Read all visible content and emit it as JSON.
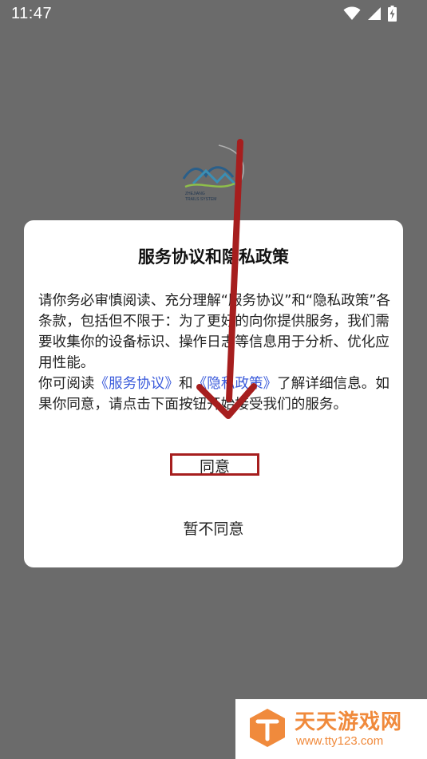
{
  "status_bar": {
    "time": "11:47",
    "icons": [
      "wifi-icon",
      "cellular-signal-icon",
      "battery-charging-icon"
    ]
  },
  "splash": {
    "logo_line1": "ZHEJIANG",
    "logo_line2": "TRAILS SYSTEM"
  },
  "dialog": {
    "title": "服务协议和隐私政策",
    "paragraph1": "请你务必审慎阅读、充分理解“服务协议”和“隐私政策”各条款，包括但不限于：为了更好的向你提供服务，我们需要收集你的设备标识、操作日志等信息用于分析、优化应用性能。",
    "p2_prefix": "你可阅读",
    "service_link": "《服务协议》",
    "p2_and": "和",
    "privacy_link": "《隐私政策》",
    "p2_suffix": "了解详细信息。如果你同意，请点击下面按钮开始接受我们的服务。",
    "agree_label": "同意",
    "decline_label": "暂不同意"
  },
  "watermark": {
    "title": "天天游戏网",
    "url": "www.tty123.com"
  },
  "colors": {
    "overlay_bg": "#6b6b6b",
    "dialog_bg": "#ffffff",
    "link": "#3b5bdb",
    "annotation_red": "#a61e1e",
    "watermark_orange": "#f08a3c"
  }
}
